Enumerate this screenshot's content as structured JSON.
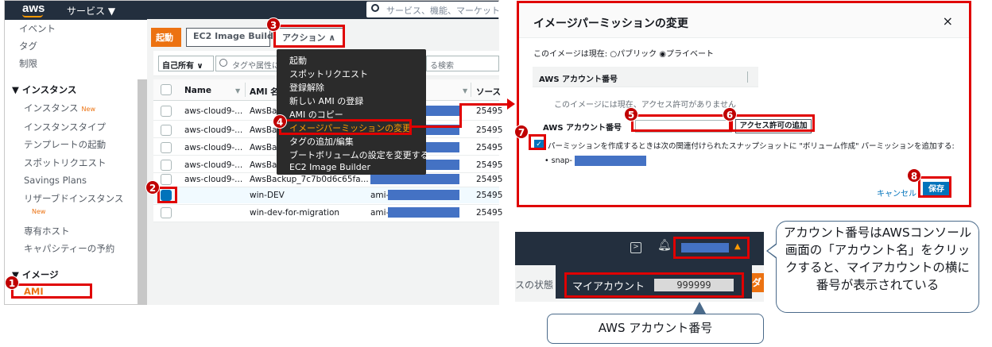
{
  "console": {
    "logo": "aws",
    "services": "サービス ▼",
    "search_placeholder": "サービス、機能、マーケット"
  },
  "sidebar": {
    "items": [
      "イベント",
      "タグ",
      "制限"
    ],
    "instances_head": "▼ インスタンス",
    "instance_items": [
      "インスタンス",
      "インスタンスタイプ",
      "テンプレートの起動",
      "スポットリクエスト",
      "Savings Plans",
      "リザーブドインスタンス",
      "専有ホスト",
      "キャパシティーの予約"
    ],
    "new_badge": "New",
    "images_head": "▼ イメージ",
    "ami": "AMI"
  },
  "toolbar": {
    "launch": "起動",
    "builder": "EC2 Image Builder",
    "actions": "アクション ∧"
  },
  "filter": {
    "owner": "自己所有 ∨",
    "placeholder": "タグや属性によ",
    "placeholder2": "る検索"
  },
  "table": {
    "headers": [
      "Name",
      "AMI 名",
      "ソース"
    ],
    "rows": [
      {
        "name": "aws-cloud9-...",
        "ami": "AwsBac",
        "source": "25495"
      },
      {
        "name": "aws-cloud9-...",
        "ami": "AwsBac",
        "source": "25495"
      },
      {
        "name": "aws-cloud9-...",
        "ami": "AwsBac",
        "source": "25495"
      },
      {
        "name": "aws-cloud9-...",
        "ami": "AwsBac",
        "source": "25495"
      },
      {
        "name": "aws-cloud9-...",
        "ami": "AwsBackup_7c7b0d6c65fa...",
        "source": "25495"
      },
      {
        "name": "",
        "ami": "win-DEV",
        "id": "ami-",
        "source": "25495"
      },
      {
        "name": "",
        "ami": "win-dev-for-migration",
        "id": "ami-",
        "source": "25495"
      }
    ]
  },
  "dropdown": {
    "items": [
      "起動",
      "スポットリクエスト",
      "登録解除",
      "新しい AMI の登録",
      "AMI のコピー",
      "イメージパーミッションの変更",
      "タグの追加/編集",
      "ブートボリュームの設定を変更する",
      "EC2 Image Builder"
    ]
  },
  "dialog": {
    "title": "イメージパーミッションの変更",
    "close": "×",
    "status": "このイメージは現在: ○パブリック ◉プライベート",
    "acct_header": "AWS アカウント番号",
    "no_perm": "このイメージには現在、アクセス許可がありません",
    "acct_label": "AWS アカウント番号",
    "add_perm": "アクセス許可の追加",
    "vol_text": "パーミッションを作成するときは次の関連付けられたスナップショットに \"ボリューム作成\" パーミッションを追加する:",
    "snap": "• snap-",
    "cancel": "キャンセル",
    "save": "保存"
  },
  "accountbar": {
    "my_account": "マイアカウント",
    "account_number": "999999",
    "state_fragment": "スの状態",
    "orange_fragment": "ダ"
  },
  "annotations": {
    "numbers": [
      "1",
      "2",
      "3",
      "4",
      "5",
      "6",
      "7",
      "8"
    ],
    "callout_right": "アカウント番号はAWSコンソール画面の「アカウント名」をクリックすると、マイアカウントの横に番号が表示されている",
    "callout_bottom": "AWS アカウント番号"
  },
  "colors": {
    "aws_nav": "#232f3e",
    "aws_orange": "#ec7211",
    "annotation_red": "#e00000",
    "redaction_blue": "#4472c4",
    "primary_blue": "#0073bb"
  }
}
